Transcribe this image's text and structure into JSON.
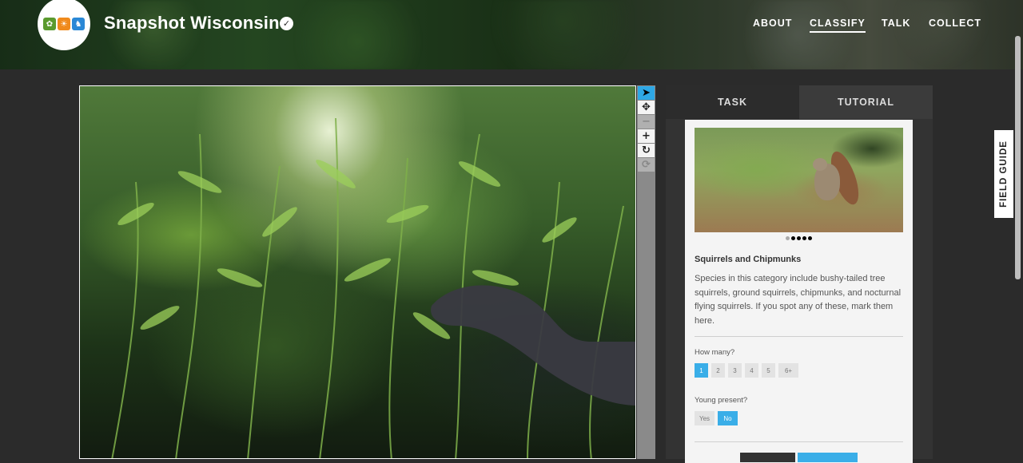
{
  "header": {
    "project_title": "Snapshot Wisconsin",
    "nav": [
      "ABOUT",
      "CLASSIFY",
      "TALK",
      "COLLECT"
    ],
    "active_nav": "CLASSIFY",
    "logo_icons": [
      "plant-icon",
      "sun-icon",
      "deer-icon"
    ],
    "logo_colors": [
      "#5a9a2e",
      "#f08a1c",
      "#2a88d6"
    ]
  },
  "toolbar": {
    "tools": [
      "pointer-icon",
      "pan-icon",
      "zoom-out-icon",
      "zoom-in-icon",
      "rotate-icon",
      "reset-icon"
    ]
  },
  "panel": {
    "tabs": [
      "TASK",
      "TUTORIAL"
    ],
    "species_title": "Squirrels and Chipmunks",
    "species_description": "Species in this category include bushy-tailed tree squirrels, ground squirrels, chipmunks, and nocturnal flying squirrels. If you spot any of these, mark them here.",
    "carousel": {
      "count": 5,
      "active": 1
    },
    "how_many": {
      "label": "How many?",
      "options": [
        "1",
        "2",
        "3",
        "4",
        "5",
        "6+"
      ],
      "selected": "1"
    },
    "young_present": {
      "label": "Young present?",
      "options": [
        "Yes",
        "No"
      ],
      "selected": "No"
    }
  },
  "field_guide": "FIELD GUIDE",
  "colors": {
    "accent": "#3aaee8",
    "panel_bg": "#333333",
    "page_bg": "#2b2b2b"
  }
}
